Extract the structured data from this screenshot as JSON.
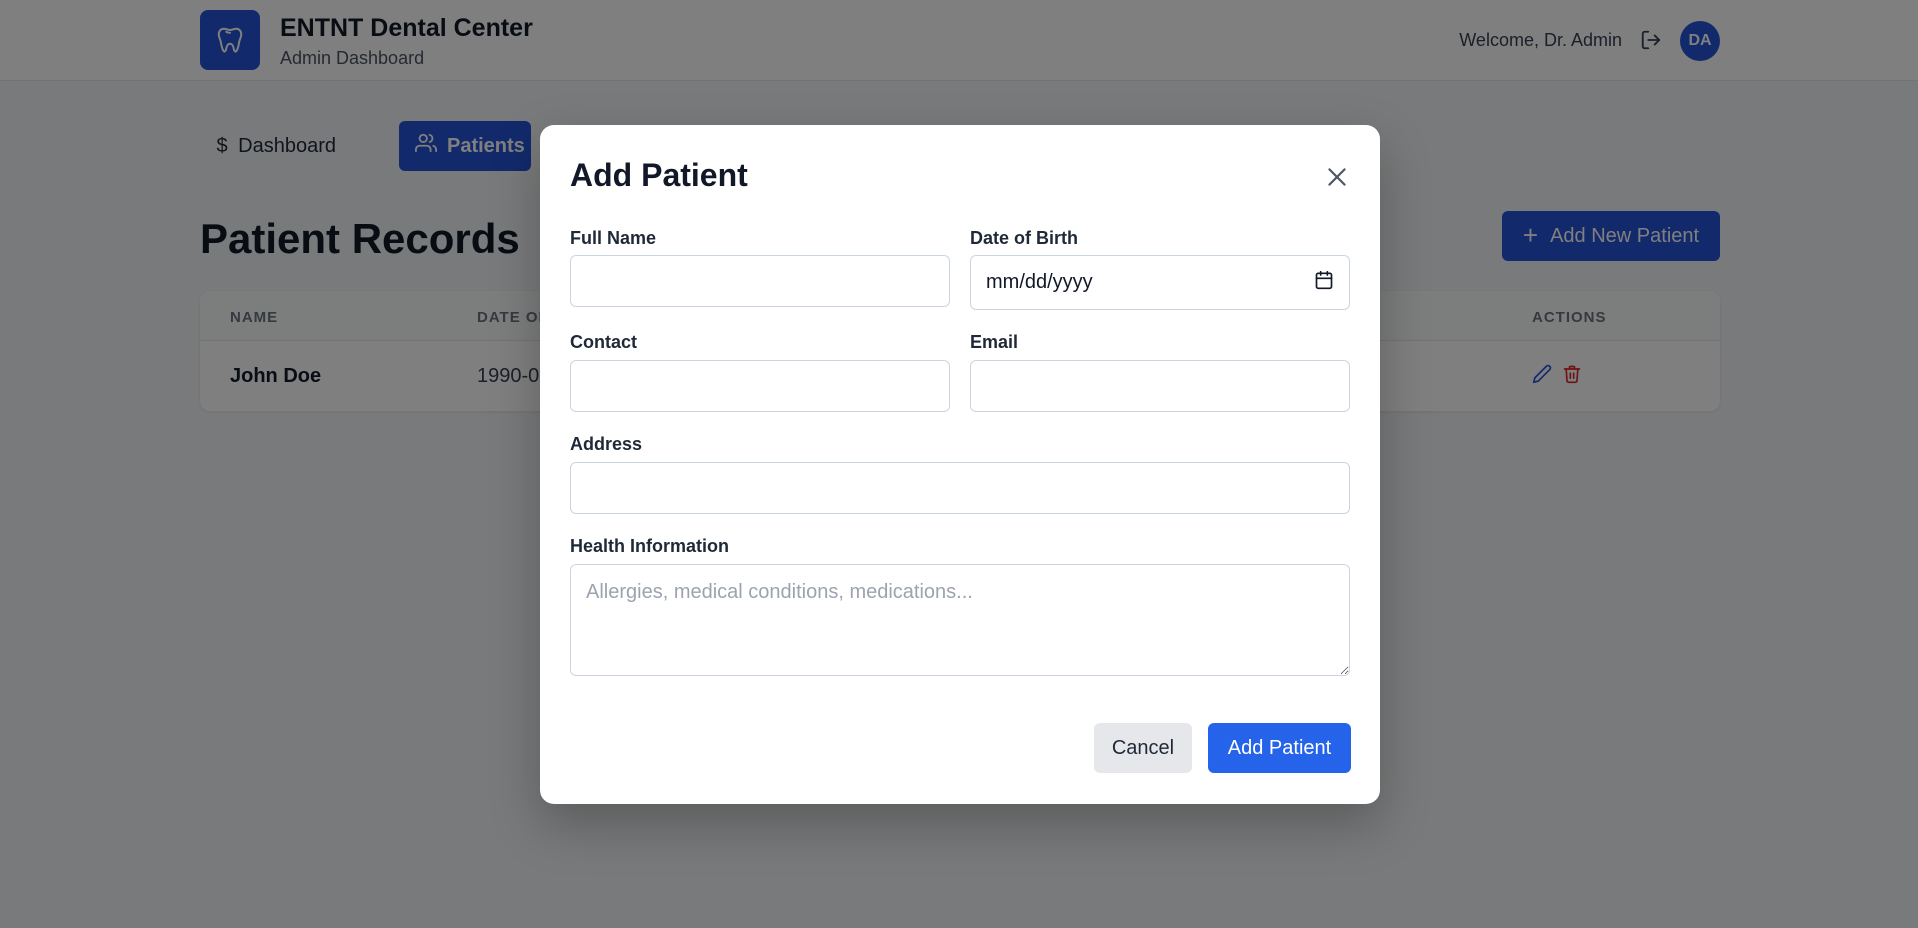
{
  "header": {
    "title": "ENTNT Dental Center",
    "subtitle": "Admin Dashboard",
    "welcome": "Welcome, Dr. Admin",
    "avatar_initials": "DA"
  },
  "nav": {
    "dashboard_label": "Dashboard",
    "patients_label": "Patients"
  },
  "page": {
    "title": "Patient Records",
    "add_button_label": "Add New Patient"
  },
  "table": {
    "columns": [
      "NAME",
      "DATE OF",
      "ACTIONS"
    ],
    "rows": [
      {
        "name": "John Doe",
        "dob": "1990-0"
      }
    ]
  },
  "modal": {
    "title": "Add Patient",
    "fields": {
      "full_name": {
        "label": "Full Name",
        "value": ""
      },
      "dob": {
        "label": "Date of Birth",
        "value": "mm/dd/yyyy"
      },
      "contact": {
        "label": "Contact",
        "value": ""
      },
      "email": {
        "label": "Email",
        "value": ""
      },
      "address": {
        "label": "Address",
        "value": ""
      },
      "health": {
        "label": "Health Information",
        "placeholder": "Allergies, medical conditions, medications..."
      }
    },
    "cancel_label": "Cancel",
    "submit_label": "Add Patient"
  },
  "colors": {
    "primary": "#2554d6",
    "submit": "#2563eb",
    "delete": "#dc2626"
  }
}
